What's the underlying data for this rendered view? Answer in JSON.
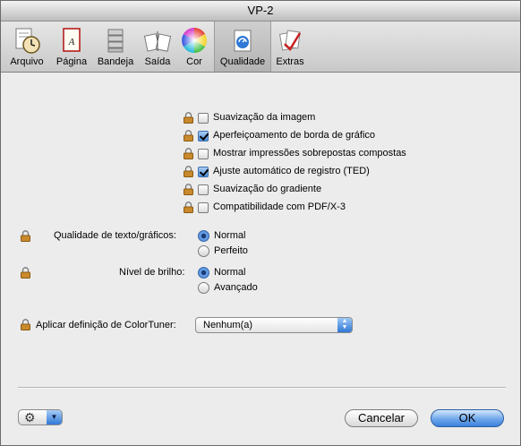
{
  "window": {
    "title": "VP-2"
  },
  "toolbar": {
    "items": [
      {
        "label": "Arquivo",
        "icon": "file-clock-icon"
      },
      {
        "label": "Página",
        "icon": "page-icon"
      },
      {
        "label": "Bandeja",
        "icon": "tray-icon"
      },
      {
        "label": "Saída",
        "icon": "output-icon"
      },
      {
        "label": "Cor",
        "icon": "color-wheel-icon"
      },
      {
        "label": "Qualidade",
        "icon": "quality-icon",
        "selected": true
      },
      {
        "label": "Extras",
        "icon": "extras-icon"
      }
    ]
  },
  "options": [
    {
      "label": "Suavização da imagem",
      "checked": false
    },
    {
      "label": "Aperfeiçoamento de borda de gráfico",
      "checked": true
    },
    {
      "label": "Mostrar impressões sobrepostas compostas",
      "checked": false
    },
    {
      "label": "Ajuste automático de registro (TED)",
      "checked": true
    },
    {
      "label": "Suavização do gradiente",
      "checked": false
    },
    {
      "label": "Compatibilidade com PDF/X-3",
      "checked": false
    }
  ],
  "quality": {
    "label": "Qualidade de texto/gráficos:",
    "options": [
      "Normal",
      "Perfeito"
    ],
    "selected": "Normal"
  },
  "brightness": {
    "label": "Nível de brilho:",
    "options": [
      "Normal",
      "Avançado"
    ],
    "selected": "Normal"
  },
  "colortuner": {
    "label": "Aplicar definição de ColorTuner:",
    "value": "Nenhum(a)"
  },
  "buttons": {
    "cancel": "Cancelar",
    "ok": "OK"
  },
  "colors": {
    "accent": "#3b81dc",
    "lock": "#c98a2c"
  }
}
